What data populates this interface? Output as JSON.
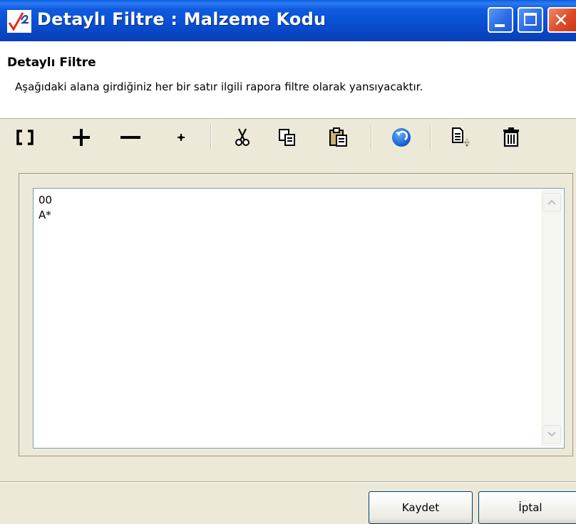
{
  "window": {
    "title": "Detaylı Filtre : Malzeme Kodu",
    "controls": [
      "minimize",
      "maximize",
      "close"
    ]
  },
  "header": {
    "title": "Detaylı Filtre",
    "description": "Aşağıdaki alana girdiğiniz her bir satır ilgili rapora filtre olarak yansıyacaktır."
  },
  "toolbar": {
    "tools": [
      {
        "name": "brackets-icon"
      },
      {
        "name": "plus-icon"
      },
      {
        "name": "minus-icon"
      },
      {
        "name": "asterisk-icon"
      },
      {
        "name": "cut-icon"
      },
      {
        "name": "copy-icon"
      },
      {
        "name": "paste-icon"
      },
      {
        "name": "undo-icon"
      },
      {
        "name": "import-icon"
      },
      {
        "name": "delete-icon"
      }
    ]
  },
  "editor": {
    "lines": [
      "00",
      "A*"
    ]
  },
  "buttons": {
    "save_label": "Kaydet",
    "cancel_label": "İptal"
  },
  "colors": {
    "titlebar": "#0a52d4",
    "close_button": "#dd4a26",
    "dialog_background": "#ece9d8",
    "editor_border": "#7f9db9",
    "button_border": "#003c74"
  }
}
